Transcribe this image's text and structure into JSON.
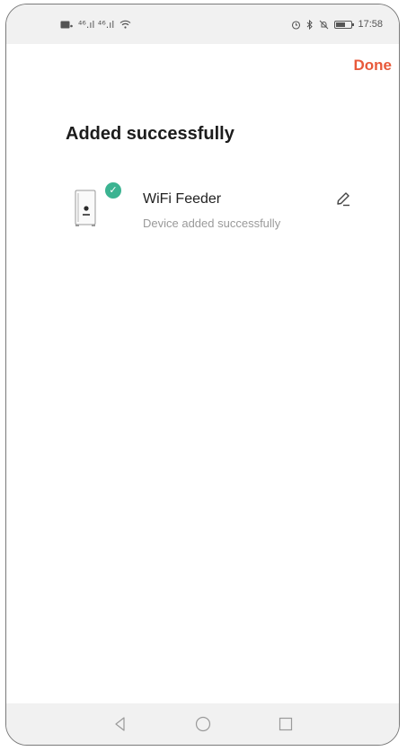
{
  "status_bar": {
    "left_icons": [
      "sim-icon",
      "signal-icon",
      "signal-icon",
      "wifi-icon"
    ],
    "signal_text": "⁴⁶.ıl ⁴⁶.ıl",
    "right_icons": [
      "alarm-icon",
      "bluetooth-icon",
      "mute-icon",
      "battery-icon"
    ],
    "time": "17:58"
  },
  "header": {
    "done_label": "Done",
    "accent_color": "#e8593a"
  },
  "main": {
    "title": "Added successfully",
    "devices": [
      {
        "name": "WiFi Feeder",
        "status": "Device added successfully",
        "badge_color": "#3bb391"
      }
    ]
  },
  "nav_bar": {
    "buttons": [
      "back-icon",
      "home-icon",
      "recents-icon"
    ]
  }
}
